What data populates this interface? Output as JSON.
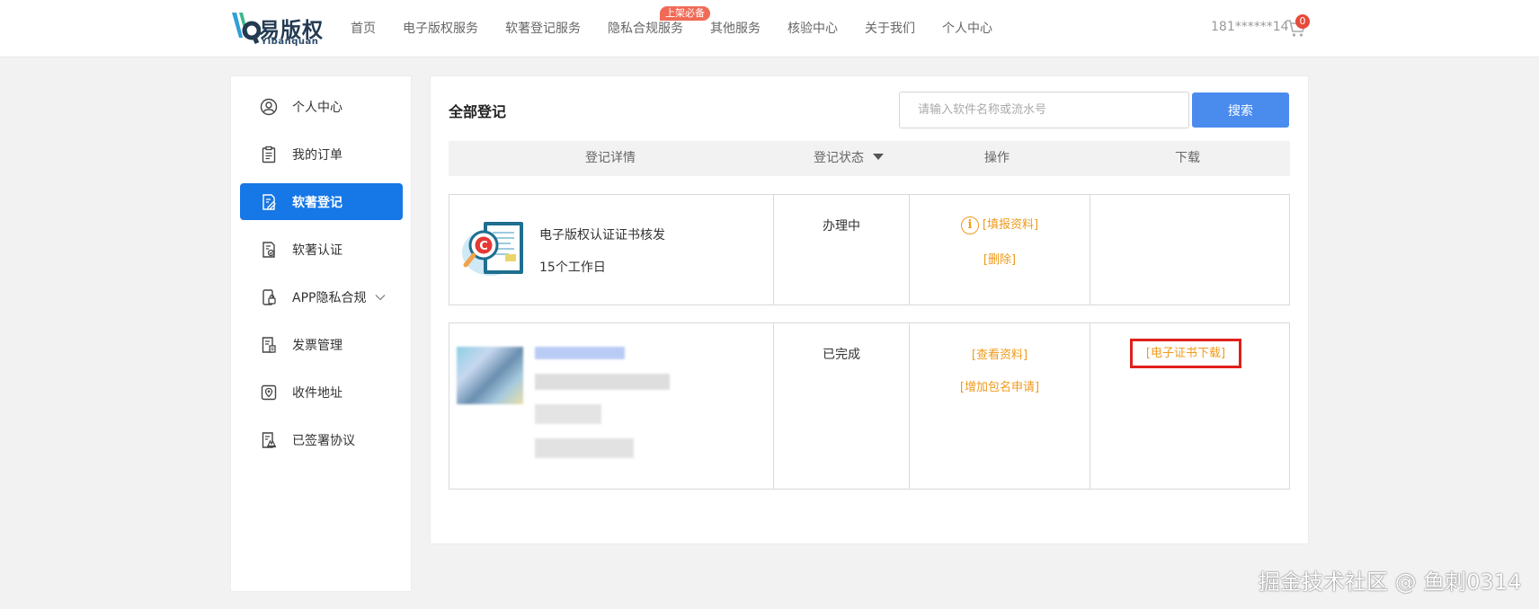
{
  "header": {
    "logo_text": "易版权",
    "logo_sub": "Yibanquan",
    "nav": [
      {
        "label": "首页"
      },
      {
        "label": "电子版权服务"
      },
      {
        "label": "软著登记服务"
      },
      {
        "label": "隐私合规服务",
        "badge": "上架必备"
      },
      {
        "label": "其他服务"
      },
      {
        "label": "核验中心"
      },
      {
        "label": "关于我们"
      },
      {
        "label": "个人中心"
      }
    ],
    "user_phone": "181******14",
    "cart_count": "0"
  },
  "sidebar": {
    "items": [
      {
        "label": "个人中心",
        "icon": "user-circle-icon"
      },
      {
        "label": "我的订单",
        "icon": "clipboard-icon"
      },
      {
        "label": "软著登记",
        "icon": "document-edit-icon",
        "active": true
      },
      {
        "label": "软著认证",
        "icon": "certificate-icon"
      },
      {
        "label": "APP隐私合规",
        "icon": "app-lock-icon"
      },
      {
        "label": "发票管理",
        "icon": "invoice-icon"
      },
      {
        "label": "收件地址",
        "icon": "location-icon"
      },
      {
        "label": "已签署协议",
        "icon": "agreement-icon"
      }
    ]
  },
  "main": {
    "title": "全部登记",
    "search": {
      "placeholder": "请输入软件名称或流水号",
      "button": "搜索"
    },
    "columns": [
      "登记详情",
      "登记状态",
      "操作",
      "下载"
    ],
    "rows": [
      {
        "name": "电子版权认证证书核发",
        "duration": "15个工作日",
        "status": "办理中",
        "actions": [
          "[填报资料]",
          "[删除]"
        ],
        "download": ""
      },
      {
        "status": "已完成",
        "actions": [
          "[查看资料]",
          "[增加包名申请]"
        ],
        "download": "[电子证书下载]"
      }
    ]
  },
  "colors": {
    "accent": "#1677e6",
    "search_button": "#4a8bee",
    "link": "#ef9a1b",
    "highlight": "#e0201b"
  },
  "watermark": "掘金技术社区 @ 鱼刺0314"
}
